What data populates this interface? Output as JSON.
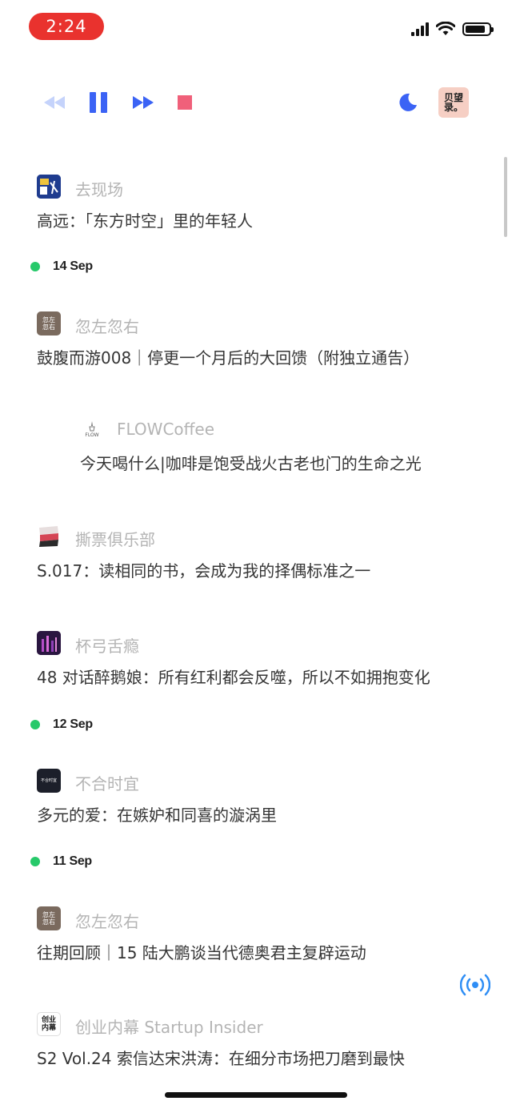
{
  "status_bar": {
    "time": "2:24"
  },
  "player": {
    "controls": [
      "rewind-icon",
      "pause-icon",
      "fast-forward-icon",
      "stop-icon"
    ],
    "sleep_timer": "moon-icon",
    "current_cover_text": "贝望录。"
  },
  "feed": [
    {
      "kind": "episode",
      "source": "去现场",
      "title": "高远：「东方时空」里的年轻人",
      "icon": "qu-xian-chang-cover"
    },
    {
      "kind": "date",
      "label": "14 Sep"
    },
    {
      "kind": "episode",
      "source": "忽左忽右",
      "title": "鼓腹而游008｜停更一个月后的大回馈（附独立通告）",
      "icon": "hu-zuo-hu-you-cover",
      "icon_text": "忽左\n忽右"
    },
    {
      "kind": "episode",
      "source": "FLOWCoffee",
      "title": "今天喝什么|咖啡是饱受战火古老也门的生命之光",
      "icon": "flow-coffee-cover",
      "icon_text": "FLOW"
    },
    {
      "kind": "episode",
      "source": "撕票俱乐部",
      "title": "S.017：读相同的书，会成为我的择偶标准之一",
      "icon": "si-piao-cover"
    },
    {
      "kind": "episode",
      "source": "杯弓舌瘾",
      "title": "48 对话醉鹅娘：所有红利都会反噬，所以不如拥抱变化",
      "icon": "bei-gong-she-yin-cover"
    },
    {
      "kind": "date",
      "label": "12 Sep"
    },
    {
      "kind": "episode",
      "source": "不合时宜",
      "title": "多元的爱：在嫉妒和同喜的漩涡里",
      "icon": "bu-he-shi-yi-cover",
      "icon_text": "不合时宜"
    },
    {
      "kind": "date",
      "label": "11 Sep"
    },
    {
      "kind": "episode",
      "source": "忽左忽右",
      "title": "往期回顾｜15 陆大鹏谈当代德奥君主复辟运动",
      "icon": "hu-zuo-hu-you-cover",
      "icon_text": "忽左\n忽右"
    },
    {
      "kind": "episode",
      "source": "创业内幕 Startup Insider",
      "title": "S2 Vol.24 索信达宋洪涛：在细分市场把刀磨到最快",
      "icon": "startup-insider-cover",
      "icon_text": "创业\n内幕"
    }
  ],
  "colors": {
    "accent_blue": "#3b63f5",
    "stop_red": "#f0607a",
    "date_dot_green": "#27c96a",
    "live_blue": "#2f8ef5",
    "time_pill_red": "#e9322e"
  }
}
